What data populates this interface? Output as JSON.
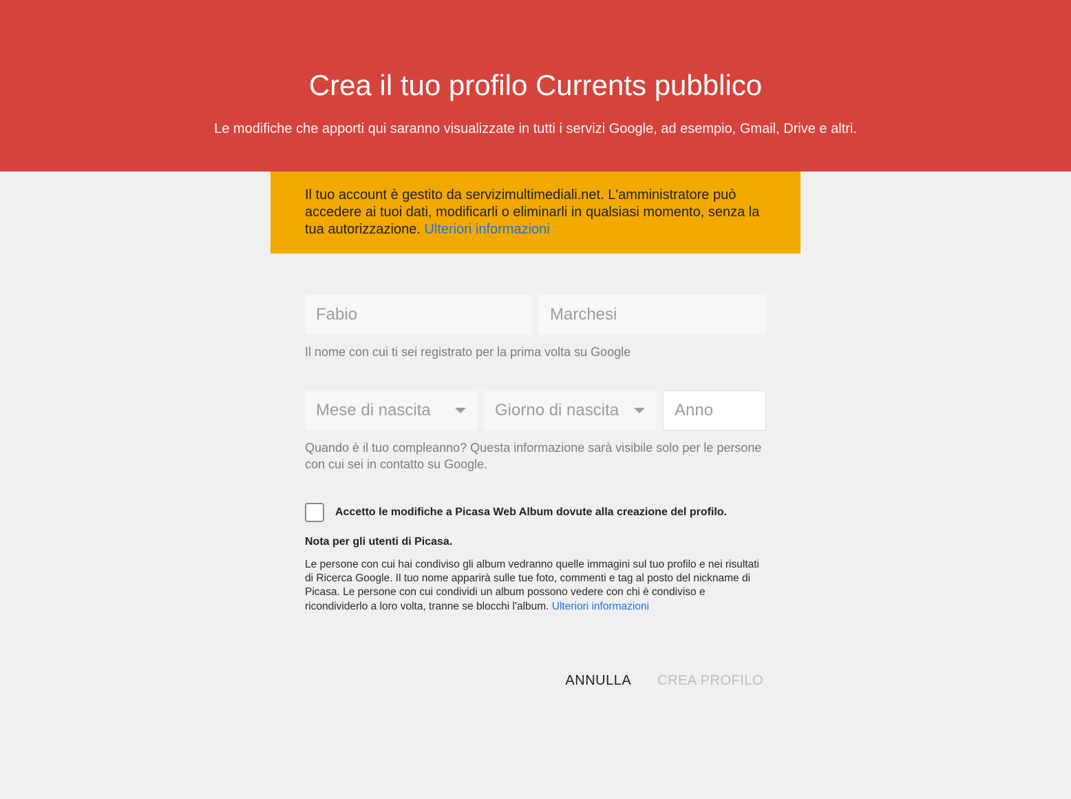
{
  "header": {
    "title": "Crea il tuo profilo Currents pubblico",
    "subtitle": "Le modifiche che apporti qui saranno visualizzate in tutti i servizi Google, ad esempio, Gmail, Drive e altri."
  },
  "notice": {
    "text": "Il tuo account è gestito da servizimultimediali.net. L'amministratore può accedere ai tuoi dati, modificarli o eliminarli in qualsiasi momento, senza la tua autorizzazione. ",
    "link": "Ulteriori informazioni"
  },
  "form": {
    "first_name": "Fabio",
    "last_name": "Marchesi",
    "name_help": "Il nome con cui ti sei registrato per la prima volta su Google",
    "birth_month_label": "Mese di nascita",
    "birth_day_label": "Giorno di nascita",
    "birth_year_placeholder": "Anno",
    "birth_help": "Quando è il tuo compleanno? Questa informazione sarà visibile solo per le persone con cui sei in contatto su Google.",
    "picasa_checkbox_label": "Accetto le modifiche a Picasa Web Album dovute alla creazione del profilo.",
    "picasa_title": "Nota per gli utenti di Picasa.",
    "picasa_body": "Le persone con cui hai condiviso gli album vedranno quelle immagini sul tuo profilo e nei risultati di Ricerca Google. Il tuo nome apparirà sulle tue foto, commenti e tag al posto del nickname di Picasa. Le persone con cui condividi un album possono vedere con chi è condiviso e ricondividerlo a loro volta, tranne se blocchi l'album. ",
    "picasa_link": "Ulteriori informazioni"
  },
  "actions": {
    "cancel": "ANNULLA",
    "create": "CREA PROFILO"
  }
}
